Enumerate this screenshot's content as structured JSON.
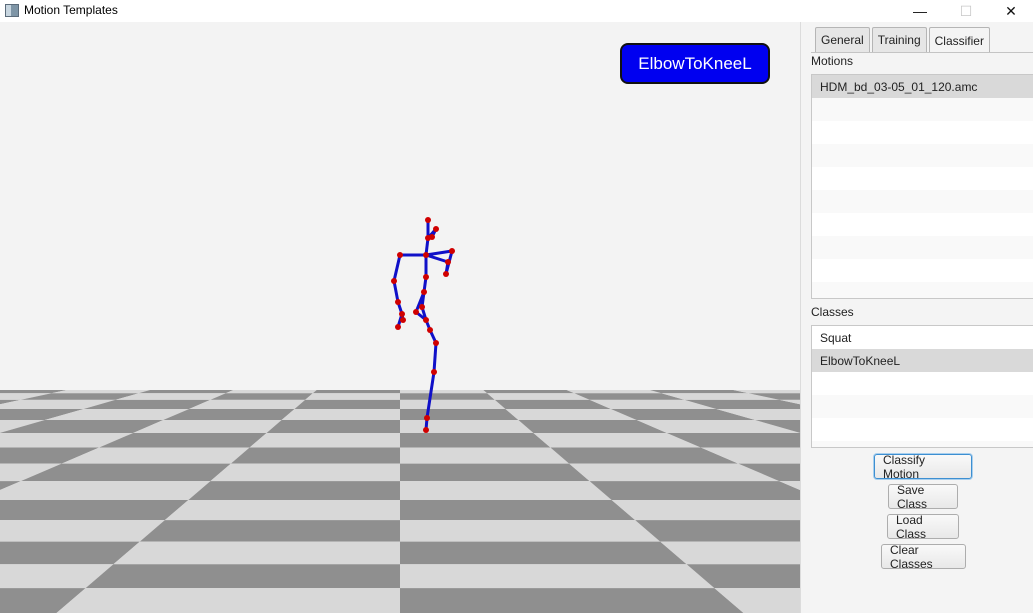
{
  "window": {
    "title": "Motion Templates",
    "min_glyph": "—",
    "max_glyph": "☐",
    "close_glyph": "✕"
  },
  "viewport": {
    "overlay_label": "ElbowToKneeL",
    "overlay_color": "#0000f0",
    "skeleton_bone_color": "#1010c8",
    "skeleton_joint_color": "#d00000",
    "floor_light": "#d8d8d8",
    "floor_dark": "#8f8f8f"
  },
  "panel": {
    "tabs": [
      {
        "label": "General"
      },
      {
        "label": "Training"
      },
      {
        "label": "Classifier"
      }
    ],
    "motions_label": "Motions",
    "motions": [
      "HDM_bd_03-05_01_120.amc"
    ],
    "classes_label": "Classes",
    "classes": [
      "Squat",
      "ElbowToKneeL"
    ],
    "buttons": {
      "classify": "Classify Motion",
      "save": "Save Class",
      "load": "Load Class",
      "clear": "Clear Classes"
    }
  }
}
